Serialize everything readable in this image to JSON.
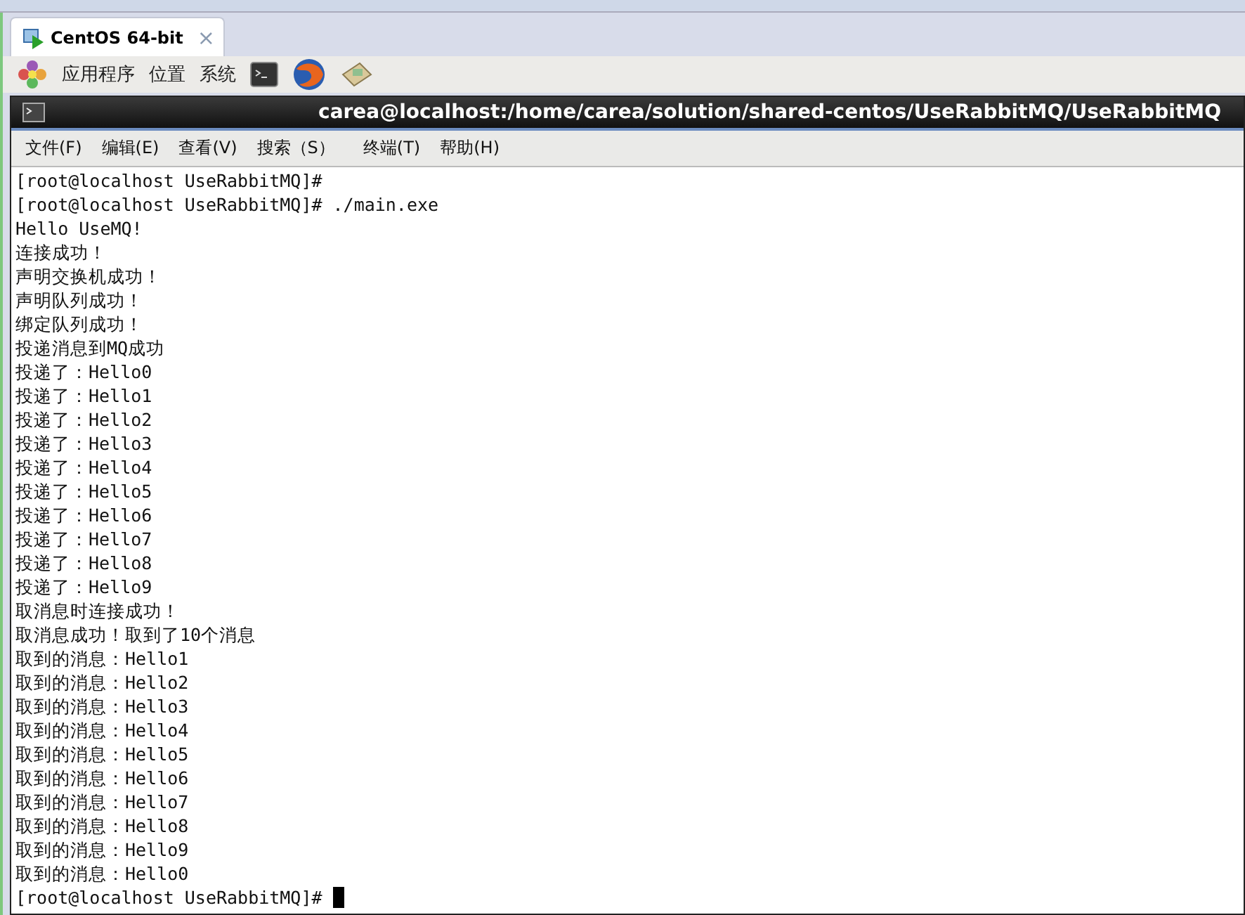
{
  "tab": {
    "label": "CentOS 64-bit",
    "close": "×"
  },
  "panel_menu": [
    "应用程序",
    "位置",
    "系统"
  ],
  "terminal": {
    "title": "carea@localhost:/home/carea/solution/shared-centos/UseRabbitMQ/UseRabbitMQ",
    "menu": [
      "文件(F)",
      "编辑(E)",
      "查看(V)",
      "搜索（S）",
      "终端(T)",
      "帮助(H)"
    ],
    "lines": [
      "[root@localhost UseRabbitMQ]#",
      "[root@localhost UseRabbitMQ]# ./main.exe",
      "Hello UseMQ!",
      "连接成功！",
      "声明交换机成功！",
      "声明队列成功！",
      "绑定队列成功！",
      "投递消息到MQ成功",
      "投递了：Hello0",
      "投递了：Hello1",
      "投递了：Hello2",
      "投递了：Hello3",
      "投递了：Hello4",
      "投递了：Hello5",
      "投递了：Hello6",
      "投递了：Hello7",
      "投递了：Hello8",
      "投递了：Hello9",
      "取消息时连接成功！",
      "取消息成功！取到了10个消息",
      "取到的消息：Hello1",
      "取到的消息：Hello2",
      "取到的消息：Hello3",
      "取到的消息：Hello4",
      "取到的消息：Hello5",
      "取到的消息：Hello6",
      "取到的消息：Hello7",
      "取到的消息：Hello8",
      "取到的消息：Hello9",
      "取到的消息：Hello0",
      "[root@localhost UseRabbitMQ]#"
    ]
  }
}
